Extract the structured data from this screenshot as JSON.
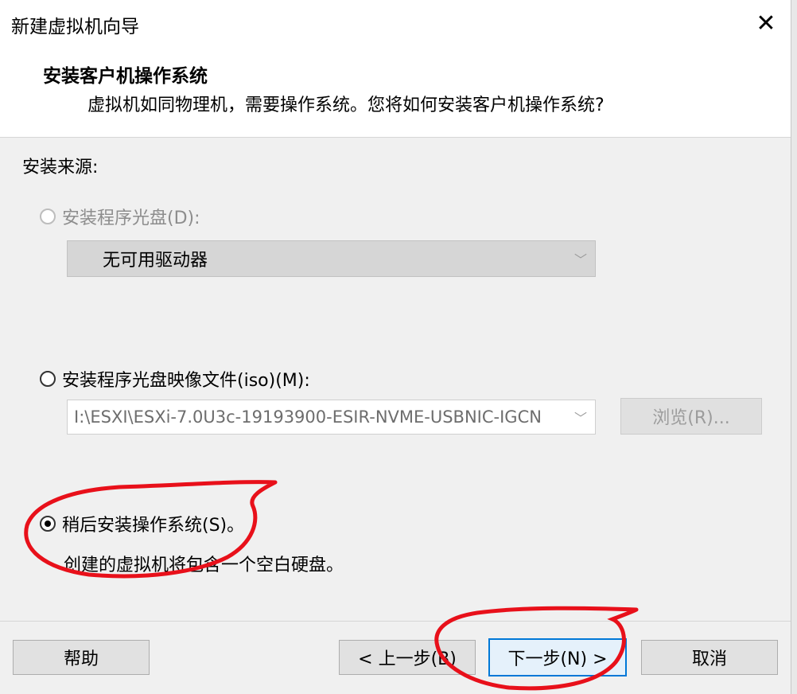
{
  "window": {
    "title": "新建虚拟机向导",
    "close_label": "✕"
  },
  "header": {
    "title": "安装客户机操作系统",
    "subtitle": "虚拟机如同物理机，需要操作系统。您将如何安装客户机操作系统?"
  },
  "install_source": {
    "label": "安装来源:",
    "option_disc": {
      "label": "安装程序光盘(D):",
      "selected": false,
      "enabled": false,
      "drive_value": "无可用驱动器"
    },
    "option_iso": {
      "label": "安装程序光盘映像文件(iso)(M):",
      "selected": false,
      "enabled": true,
      "path_value": "I:\\ESXI\\ESXi-7.0U3c-19193900-ESIR-NVME-USBNIC-IGCN",
      "browse_label": "浏览(R)..."
    },
    "option_later": {
      "label": "稍后安装操作系统(S)。",
      "selected": true,
      "description": "创建的虚拟机将包含一个空白硬盘。"
    }
  },
  "footer": {
    "help_label": "帮助",
    "back_label": "< 上一步(B)",
    "next_label": "下一步(N) >",
    "cancel_label": "取消"
  },
  "icons": {
    "dropdown": "chevron-down-icon",
    "close": "close-icon"
  },
  "colors": {
    "annotation_red": "#e8101a",
    "default_button_border": "#0078d7"
  }
}
